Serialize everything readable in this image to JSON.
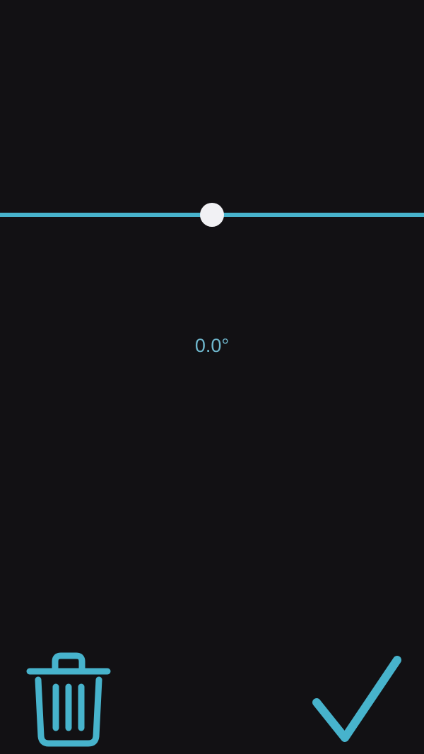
{
  "colors": {
    "background": "#121114",
    "accent": "#47b3cc",
    "readout_text": "#6fb7cd",
    "thumb": "#f1f1f4"
  },
  "rotation_slider": {
    "value_fraction": 0.5
  },
  "readout": {
    "angle_text": "0.0°"
  },
  "actions": {
    "delete_icon": "trash-icon",
    "confirm_icon": "checkmark-icon"
  }
}
